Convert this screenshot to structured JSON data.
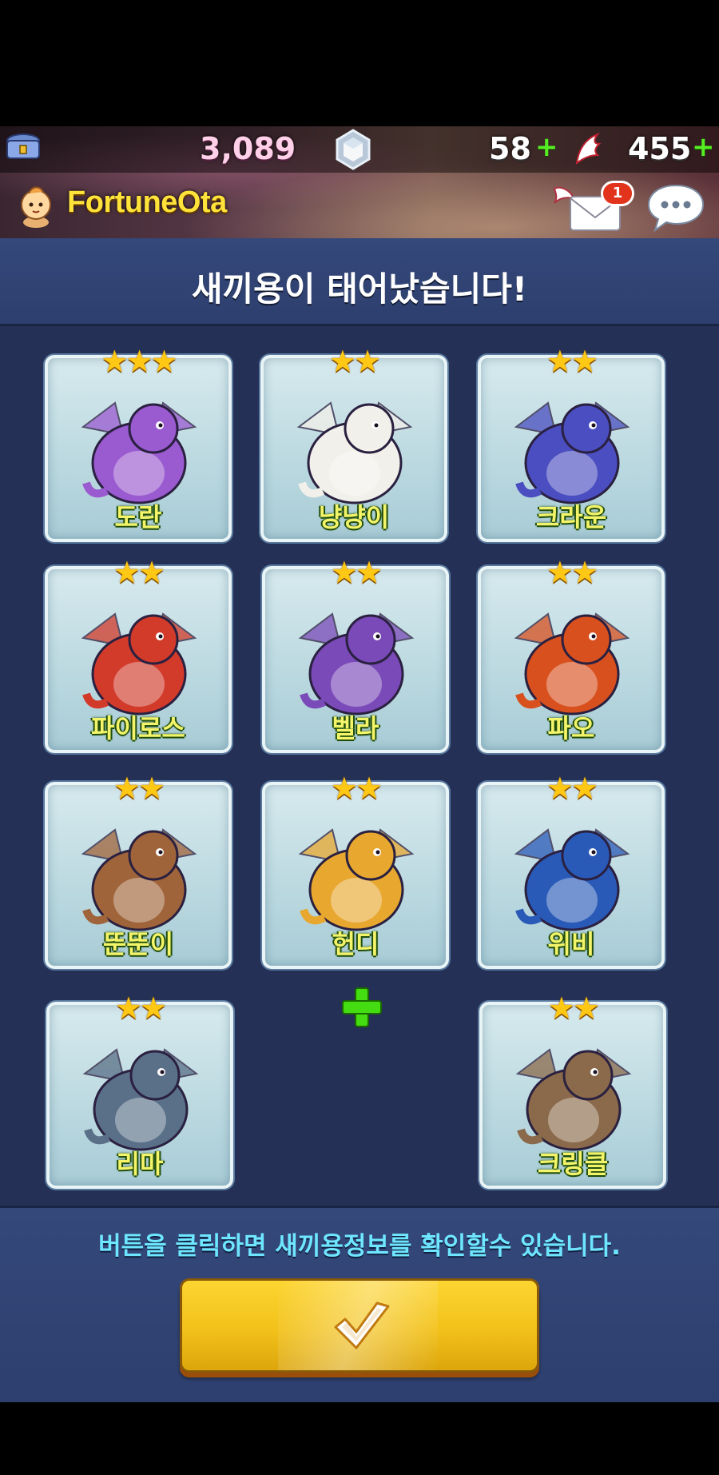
{
  "hud": {
    "gold": "3,089",
    "hearts": "58",
    "wings": "455",
    "plus": "+",
    "username": "FortuneOta",
    "mail_badge": "1"
  },
  "dialog": {
    "title": "새끼용이 태어났습니다!",
    "info": "버튼을 클릭하면 새끼용정보를 확인할수 있습니다."
  },
  "dragons": [
    {
      "name": "도란",
      "stars": 3,
      "star_text": "★★★",
      "color": "#9a5ad0"
    },
    {
      "name": "냥냥이",
      "stars": 2,
      "star_text": "★★",
      "color": "#f2f0ea"
    },
    {
      "name": "크라운",
      "stars": 2,
      "star_text": "★★",
      "color": "#4a4ec0"
    },
    {
      "name": "파이로스",
      "stars": 2,
      "star_text": "★★",
      "color": "#d23a2a"
    },
    {
      "name": "벨라",
      "stars": 2,
      "star_text": "★★",
      "color": "#7a4ab8"
    },
    {
      "name": "파오",
      "stars": 2,
      "star_text": "★★",
      "color": "#d8501e"
    },
    {
      "name": "뚠뚠이",
      "stars": 2,
      "star_text": "★★",
      "color": "#a0643a"
    },
    {
      "name": "헌디",
      "stars": 2,
      "star_text": "★★",
      "color": "#e8a830"
    },
    {
      "name": "위비",
      "stars": 2,
      "star_text": "★★",
      "color": "#2a5ab8"
    },
    {
      "name": "리마",
      "stars": 2,
      "star_text": "★★",
      "color": "#5a7088"
    },
    {
      "name": "크링클",
      "stars": 2,
      "star_text": "★★",
      "color": "#8a6a4a"
    }
  ],
  "colors": {
    "panel": "#243055",
    "title_bar": "#2d3f6e",
    "button": "#f2c11a",
    "info_text": "#6fe6ff",
    "name_text": "#f4f46a",
    "star": "#ffc814"
  },
  "icons": {
    "chest": "treasure-chest-icon",
    "gem": "gem-icon",
    "wing": "wing-icon",
    "mail": "mail-icon",
    "chat": "chat-icon",
    "check": "check-icon",
    "plus": "plus-icon"
  }
}
